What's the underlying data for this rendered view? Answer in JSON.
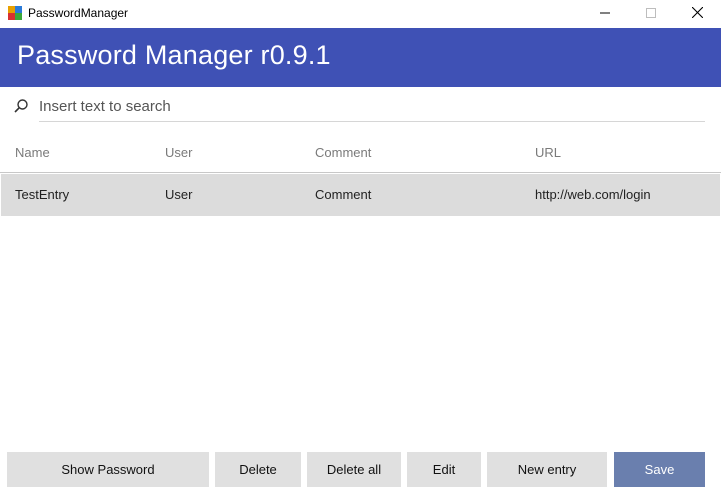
{
  "window": {
    "title": "PasswordManager",
    "controls": {
      "minimize_icon": "minimize-icon",
      "maximize_icon": "maximize-icon",
      "close_icon": "close-icon"
    }
  },
  "header": {
    "title": "Password Manager r0.9.1",
    "background_color": "#3f51b5"
  },
  "search": {
    "icon": "search-icon",
    "placeholder": "Insert text to search",
    "value": ""
  },
  "table": {
    "columns": [
      "Name",
      "User",
      "Comment",
      "URL"
    ],
    "rows": [
      {
        "name": "TestEntry",
        "user": "User",
        "comment": "Comment",
        "url": "http://web.com/login",
        "selected": true
      }
    ]
  },
  "actions": {
    "show_password": "Show Password",
    "delete": "Delete",
    "delete_all": "Delete all",
    "edit": "Edit",
    "new_entry": "New entry",
    "save": "Save",
    "save_color": "#6a7fae"
  }
}
